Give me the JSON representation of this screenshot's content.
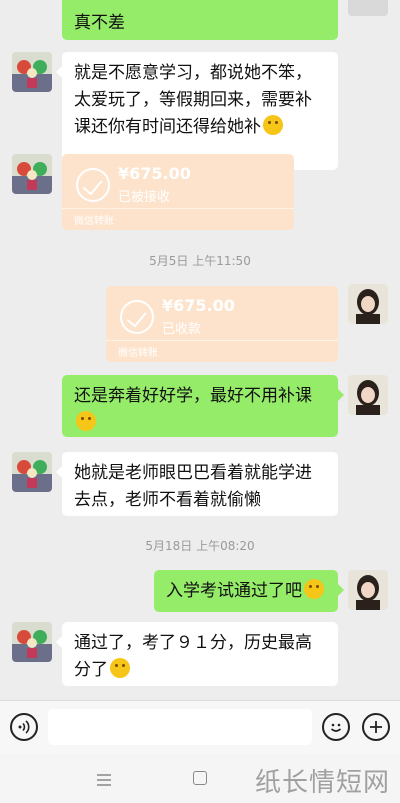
{
  "messages": {
    "m0_line2": "真不差",
    "m1": "就是不愿意学习，都说她不笨，太爱玩了，等假期回来，需要补课还你有时间还得给她补",
    "m3": "还是奔着好好学，最好不用补课",
    "m4": "她就是老师眼巴巴看着就能学进去点，老师不看着就偷懒",
    "m5": "入学考试通过了吧",
    "m6": "通过了，考了９１分，历史最高分了"
  },
  "transfers": {
    "t1": {
      "amount": "¥675.00",
      "status": "已被接收",
      "footer": "微信转账"
    },
    "t2": {
      "amount": "¥675.00",
      "status": "已收款",
      "footer": "微信转账"
    }
  },
  "timestamps": {
    "ts1": "5月5日 上午11:50",
    "ts2": "5月18日 上午08:20"
  },
  "icons": {
    "voice": "voice-icon",
    "emoji": "emoji-icon",
    "plus": "plus-icon",
    "menu": "menu-icon",
    "home": "home-icon"
  },
  "watermark": "纸长情短网",
  "colors": {
    "green_bubble": "#95ec69",
    "transfer_bg": "#fde3cc",
    "background": "#ededed"
  }
}
